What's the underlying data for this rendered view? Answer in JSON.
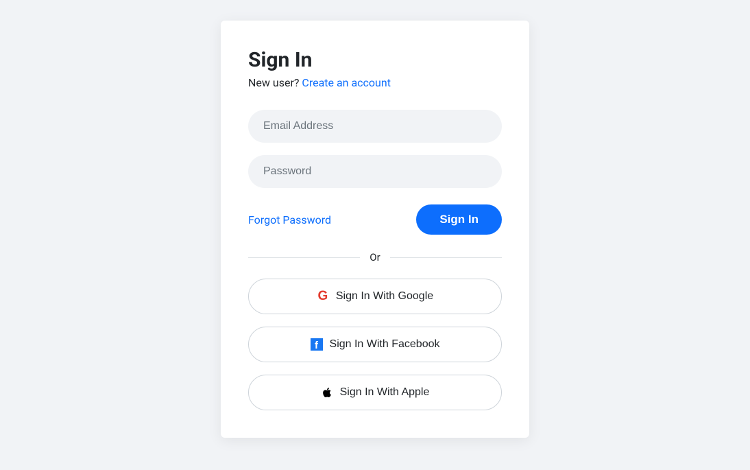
{
  "header": {
    "title": "Sign In",
    "new_user_text": "New user? ",
    "create_account_link": "Create an account"
  },
  "form": {
    "email_placeholder": "Email Address",
    "password_placeholder": "Password",
    "forgot_password": "Forgot Password",
    "sign_in_button": "Sign In"
  },
  "divider": {
    "text": "Or"
  },
  "social": {
    "google": "Sign In With Google",
    "facebook": "Sign In With Facebook",
    "apple": "Sign In With Apple"
  }
}
